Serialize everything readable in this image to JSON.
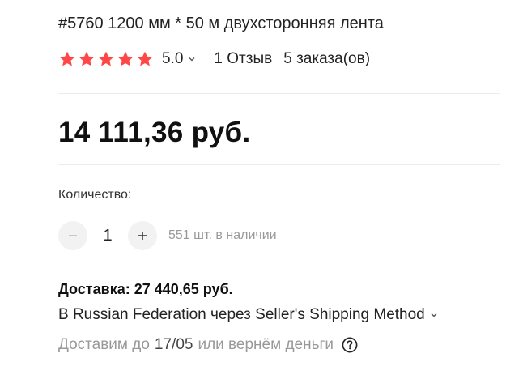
{
  "product": {
    "title": "#5760 1200 мм * 50 м двухсторонняя лента",
    "rating": "5.0",
    "stars": 5,
    "reviews": "1 Отзыв",
    "orders": "5 заказа(ов)"
  },
  "price": {
    "value": "14 111,36 руб."
  },
  "quantity": {
    "label": "Количество:",
    "value": "1",
    "stock": "551 шт. в наличии"
  },
  "delivery": {
    "title": "Доставка: 27 440,65 руб.",
    "method": "В Russian Federation через Seller's Shipping Method",
    "eta_prefix": "Доставим до",
    "eta_date": "17/05",
    "eta_suffix": "или вернём деньги"
  },
  "colors": {
    "star": "#ff4747",
    "accent": "#111111",
    "muted": "#999999"
  },
  "icons": {
    "star": "star-icon",
    "chevron": "chevron-down-icon",
    "minus": "minus-icon",
    "plus": "plus-icon",
    "help": "help-icon"
  }
}
